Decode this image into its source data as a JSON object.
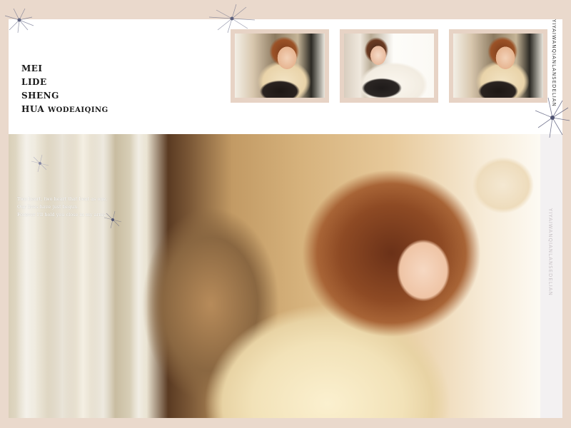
{
  "title": {
    "line1": "MEI",
    "line2": "LIDE",
    "line3": "SHENG",
    "line4_a": "HUA",
    "line4_b": "WODEAIQING"
  },
  "poem": [
    "Two heart, two heart that beat as one.",
    "Our lives have just begun.",
    "Forever I'll hold you close in my arms."
  ],
  "vertical_text_top": "YIYAIWANQIANLANSEDELIAN",
  "vertical_text_bottom": "YIYAIWANQIANLANSEDELIAN",
  "colors": {
    "page_background": "#ead9cc",
    "thumbnail_frame": "#e7d3c5",
    "title_text": "#1a1a1a"
  },
  "thumbnails": [
    {
      "name": "thumbnail-1",
      "description": ""
    },
    {
      "name": "thumbnail-2",
      "description": ""
    },
    {
      "name": "thumbnail-3",
      "description": ""
    }
  ]
}
